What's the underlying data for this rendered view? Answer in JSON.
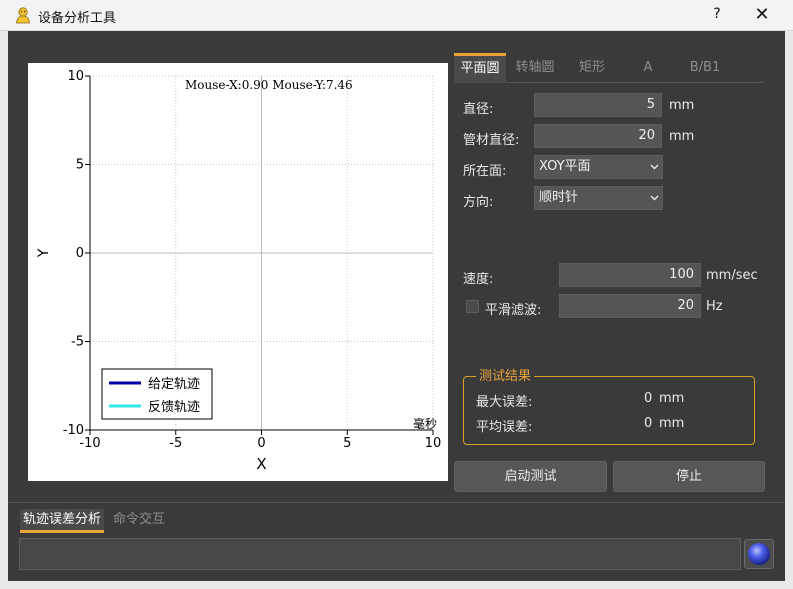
{
  "window": {
    "title": "设备分析工具",
    "help_label": "?",
    "close_label": "✕"
  },
  "plot": {
    "overlay_text": "Mouse-X:0.90 Mouse-Y:7.46",
    "corner_text": "毫秒"
  },
  "chart_data": {
    "type": "line",
    "title": "",
    "xlabel": "X",
    "ylabel": "Y",
    "xlim": [
      -10,
      10
    ],
    "ylim": [
      -10,
      10
    ],
    "xticks": [
      "-10",
      "-5",
      "0",
      "5",
      "10"
    ],
    "yticks": [
      "10",
      "5",
      "0",
      "-5",
      "-10"
    ],
    "grid": true,
    "legend_position": "bottom-left",
    "series": [
      {
        "name": "给定轨迹",
        "color": "#0000aa",
        "x": [],
        "y": []
      },
      {
        "name": "反馈轨迹",
        "color": "#33e5e5",
        "x": [],
        "y": []
      }
    ]
  },
  "tabs": [
    "平面圆",
    "转轴圆",
    "矩形",
    "A",
    "B/B1"
  ],
  "form": {
    "diameter": {
      "label": "直径:",
      "value": "5",
      "unit": "mm"
    },
    "tube_diameter": {
      "label": "管材直径:",
      "value": "20",
      "unit": "mm"
    },
    "plane": {
      "label": "所在面:",
      "value": "XOY平面"
    },
    "direction": {
      "label": "方向:",
      "value": "顺时针"
    },
    "speed": {
      "label": "速度:",
      "value": "100",
      "unit": "mm/sec"
    },
    "filter": {
      "label": "平滑滤波:",
      "value": "20",
      "unit": "Hz",
      "checked": false
    }
  },
  "results": {
    "title": "测试结果",
    "max_error": {
      "label": "最大误差:",
      "value": "0",
      "unit": "mm"
    },
    "avg_error": {
      "label": "平均误差:",
      "value": "0",
      "unit": "mm"
    }
  },
  "buttons": {
    "start": "启动测试",
    "stop": "停止"
  },
  "bottom_tabs": [
    "轨迹误差分析",
    "命令交互"
  ],
  "command": {
    "value": ""
  },
  "colors": {
    "accent": "#e8a33a",
    "panel": "#3a3a3a"
  }
}
